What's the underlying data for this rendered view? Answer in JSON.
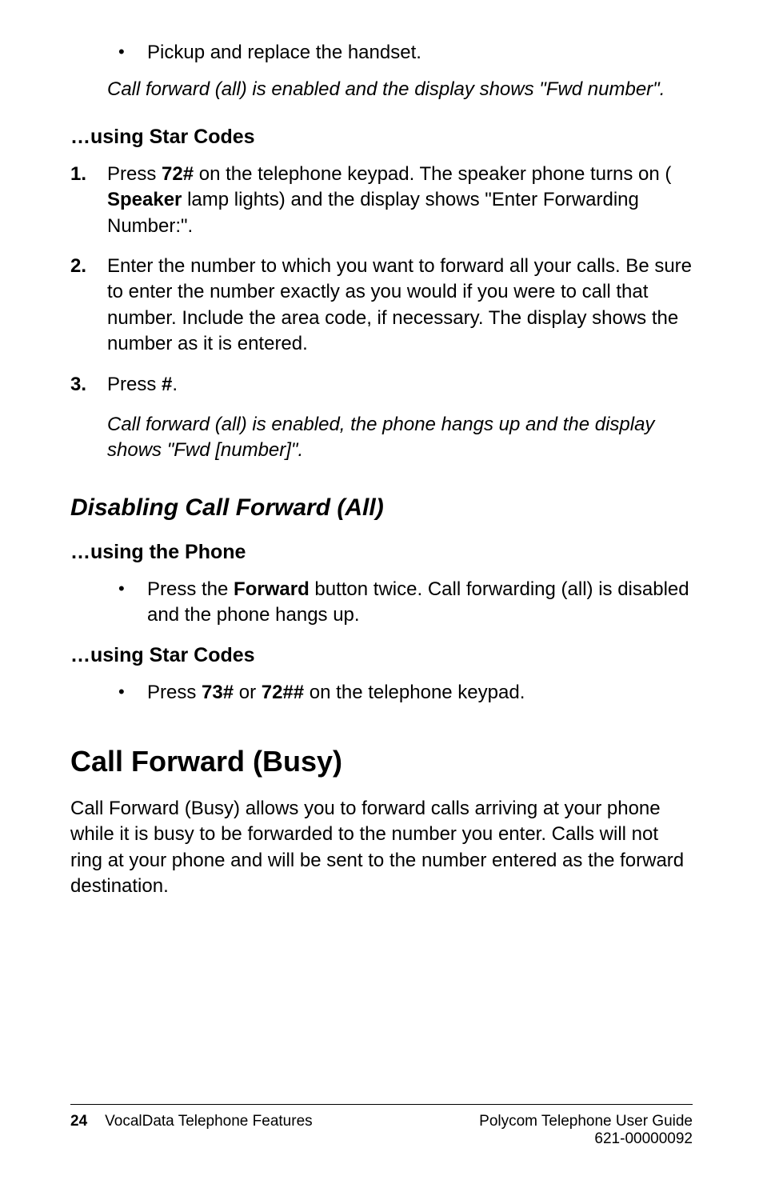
{
  "bullet1": "Pickup and replace the handset.",
  "italic1": "Call forward (all) is enabled and the display shows \"Fwd number\".",
  "h3_star1": "…using Star Codes",
  "ol1": {
    "n1": "1.",
    "t1a": "Press ",
    "t1b": "72#",
    "t1c": " on the telephone keypad. The speaker phone turns on ( ",
    "t1d": "Speaker",
    "t1e": " lamp lights) and the display shows \"Enter Forwarding Number:\".",
    "n2": "2.",
    "t2": "Enter the number to which you want to forward all your calls. Be sure to enter the number exactly as you would if you were to call that number. Include the area code, if necessary. The display shows the number as it is entered.",
    "n3": "3.",
    "t3a": "Press ",
    "t3b": "#",
    "t3c": "."
  },
  "italic2": "Call forward (all) is enabled, the phone hangs up and the display shows \"Fwd [number]\".",
  "h2_disable": "Disabling Call Forward (All)",
  "h3_phone": "…using the Phone",
  "bullet2a": "Press the ",
  "bullet2b": "Forward",
  "bullet2c": " button twice. Call forwarding (all) is disabled and the phone hangs up.",
  "h3_star2": "…using Star Codes",
  "bullet3a": "Press ",
  "bullet3b": "73#",
  "bullet3c": " or ",
  "bullet3d": "72##",
  "bullet3e": " on the telephone keypad.",
  "h1_busy": "Call Forward (Busy)",
  "para_busy": "Call Forward (Busy) allows you to forward calls arriving at your phone while it is busy to be forwarded to the number you enter. Calls will not ring at your phone and will be sent to the number entered as the forward destination.",
  "footer": {
    "page": "24",
    "left": "VocalData Telephone Features",
    "right1": "Polycom Telephone User Guide",
    "right2": "621-00000092"
  }
}
